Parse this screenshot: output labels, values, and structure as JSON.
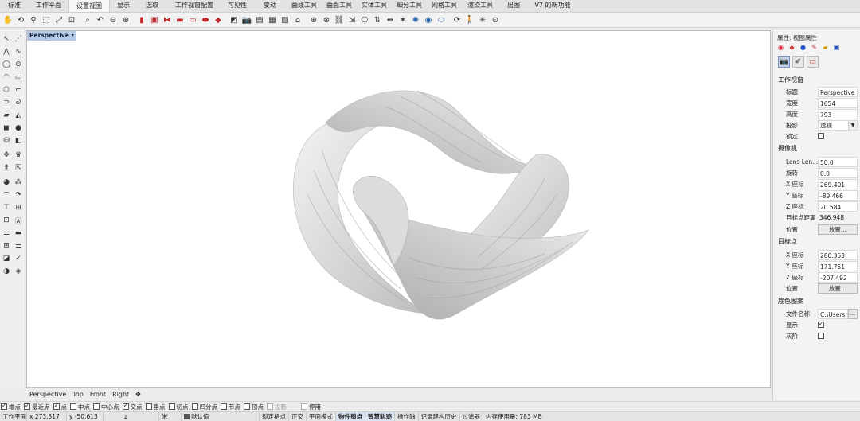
{
  "tabs": [
    {
      "label": "标准",
      "active": false
    },
    {
      "label": "工作平面",
      "active": false
    },
    {
      "label": "设置视图",
      "active": true
    },
    {
      "label": "显示",
      "active": false
    },
    {
      "label": "选取",
      "active": false
    },
    {
      "label": "工作视窗配置",
      "active": false
    },
    {
      "label": "可见性",
      "active": false
    },
    {
      "label": "变动",
      "active": false
    },
    {
      "label": "曲线工具",
      "active": false
    },
    {
      "label": "曲面工具",
      "active": false
    },
    {
      "label": "实体工具",
      "active": false
    },
    {
      "label": "细分工具",
      "active": false
    },
    {
      "label": "网格工具",
      "active": false
    },
    {
      "label": "渲染工具",
      "active": false
    },
    {
      "label": "出图",
      "active": false
    },
    {
      "label": "V7 的新功能",
      "active": false
    }
  ],
  "viewport": {
    "title": "Perspective",
    "dropdown_glyph": "▾"
  },
  "viewport_tabs": [
    "Perspective",
    "Top",
    "Front",
    "Right",
    "✥"
  ],
  "osnaps": [
    {
      "label": "端点",
      "checked": true,
      "disabled": false
    },
    {
      "label": "最近点",
      "checked": true,
      "disabled": false
    },
    {
      "label": "点",
      "checked": true,
      "disabled": false
    },
    {
      "label": "中点",
      "checked": false,
      "disabled": false
    },
    {
      "label": "中心点",
      "checked": false,
      "disabled": false
    },
    {
      "label": "交点",
      "checked": true,
      "disabled": false
    },
    {
      "label": "垂点",
      "checked": false,
      "disabled": false
    },
    {
      "label": "切点",
      "checked": false,
      "disabled": false
    },
    {
      "label": "四分点",
      "checked": false,
      "disabled": false
    },
    {
      "label": "节点",
      "checked": false,
      "disabled": false
    },
    {
      "label": "顶点",
      "checked": false,
      "disabled": false
    },
    {
      "label": "投影",
      "checked": false,
      "disabled": true
    },
    {
      "label": "停用",
      "checked": false,
      "disabled": true
    }
  ],
  "status": {
    "cplane": "工作平面",
    "x": "x 273.317",
    "y": "y -50.613",
    "z": "z",
    "unit": "米",
    "layer": "默认值",
    "items": [
      "锁定格点",
      "正交",
      "平面模式",
      "物件锁点",
      "智慧轨迹",
      "操作轴",
      "记录建构历史",
      "过滤器",
      "内存使用量: 783 MB"
    ]
  },
  "panel": {
    "title": "属性: 视图属性",
    "sections": {
      "viewport": "工作视窗",
      "camera": "摄像机",
      "target": "目标点",
      "wallpaper": "底色图案"
    },
    "viewport_rows": {
      "title_label": "标题",
      "title_value": "Perspective",
      "width_label": "宽度",
      "width_value": "1654",
      "height_label": "高度",
      "height_value": "793",
      "projection_label": "投影",
      "projection_value": "透视",
      "locked_label": "锁定"
    },
    "camera_rows": {
      "lens_label": "Lens Len...",
      "lens_value": "50.0",
      "rotation_label": "旋转",
      "rotation_value": "0.0",
      "x_label": "X 座标",
      "x_value": "269.401",
      "y_label": "Y 座标",
      "y_value": "-89.466",
      "z_label": "Z 座标",
      "z_value": "20.584",
      "dist_label": "目标点距离",
      "dist_value": "346.948",
      "pos_label": "位置",
      "place_button": "放置..."
    },
    "target_rows": {
      "x_label": "X 座标",
      "x_value": "280.353",
      "y_label": "Y 座标",
      "y_value": "171.751",
      "z_label": "Z 座标",
      "z_value": "-207.492",
      "pos_label": "位置",
      "place_button": "放置..."
    },
    "wallpaper_rows": {
      "file_label": "文件名称",
      "file_value": "C:\\Users...",
      "browse_button": "...",
      "show_label": "显示",
      "gray_label": "灰阶"
    }
  },
  "colors": {
    "accent": "#b8c9e8",
    "active_tab": "#f7f7f7"
  }
}
